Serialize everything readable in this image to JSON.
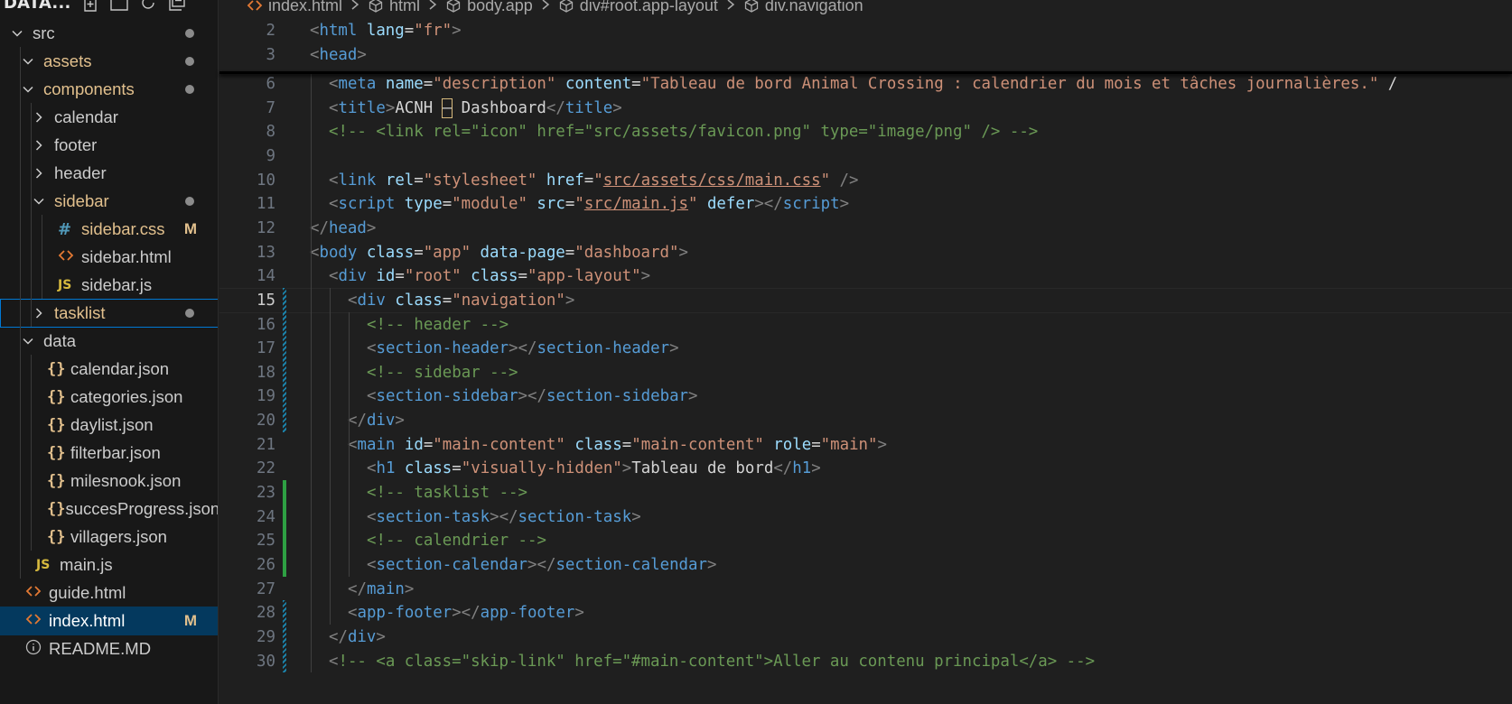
{
  "explorer": {
    "title": "DATA...",
    "tree": [
      {
        "label": "src",
        "kind": "folder-open",
        "depth": 0,
        "status": "dot"
      },
      {
        "label": "assets",
        "kind": "folder-open",
        "depth": 1,
        "status": "dot",
        "modified": true
      },
      {
        "label": "components",
        "kind": "folder-open",
        "depth": 1,
        "status": "dot",
        "modified": true
      },
      {
        "label": "calendar",
        "kind": "folder-closed",
        "depth": 2
      },
      {
        "label": "footer",
        "kind": "folder-closed",
        "depth": 2
      },
      {
        "label": "header",
        "kind": "folder-closed",
        "depth": 2
      },
      {
        "label": "sidebar",
        "kind": "folder-open",
        "depth": 2,
        "status": "dot",
        "modified": true
      },
      {
        "label": "sidebar.css",
        "kind": "css",
        "icon": "#",
        "depth": 3,
        "badge": "M",
        "modified": true
      },
      {
        "label": "sidebar.html",
        "kind": "html",
        "icon": "<>",
        "depth": 3
      },
      {
        "label": "sidebar.js",
        "kind": "js",
        "icon": "JS",
        "depth": 3
      },
      {
        "label": "tasklist",
        "kind": "folder-closed",
        "depth": 2,
        "status": "dot",
        "modified": true,
        "focused": true
      },
      {
        "label": "data",
        "kind": "folder-open",
        "depth": 1
      },
      {
        "label": "calendar.json",
        "kind": "json",
        "icon": "{}",
        "depth": 2
      },
      {
        "label": "categories.json",
        "kind": "json",
        "icon": "{}",
        "depth": 2
      },
      {
        "label": "daylist.json",
        "kind": "json",
        "icon": "{}",
        "depth": 2
      },
      {
        "label": "filterbar.json",
        "kind": "json",
        "icon": "{}",
        "depth": 2
      },
      {
        "label": "milesnook.json",
        "kind": "json",
        "icon": "{}",
        "depth": 2
      },
      {
        "label": "succesProgress.json",
        "kind": "json",
        "icon": "{}",
        "depth": 2
      },
      {
        "label": "villagers.json",
        "kind": "json",
        "icon": "{}",
        "depth": 2
      },
      {
        "label": "main.js",
        "kind": "js",
        "icon": "JS",
        "depth": 1
      },
      {
        "label": "guide.html",
        "kind": "html",
        "icon": "<>",
        "depth": 0
      },
      {
        "label": "index.html",
        "kind": "html",
        "icon": "<>",
        "depth": 0,
        "badge": "M",
        "active": true
      },
      {
        "label": "README.MD",
        "kind": "info",
        "depth": 0
      }
    ]
  },
  "breadcrumb": [
    "index.html",
    "html",
    "body.app",
    "div#root.app-layout",
    "div.navigation"
  ],
  "editor": {
    "current_line": 15,
    "lines": [
      {
        "n": 2,
        "indent": 0,
        "tokens": [
          [
            "br",
            "<"
          ],
          [
            "tag",
            "html"
          ],
          [
            "t",
            " "
          ],
          [
            "attr",
            "lang"
          ],
          [
            "eq",
            "="
          ],
          [
            "str",
            "\"fr\""
          ],
          [
            "br",
            ">"
          ]
        ]
      },
      {
        "n": 3,
        "indent": 0,
        "tokens": [
          [
            "br",
            "<"
          ],
          [
            "tag",
            "head"
          ],
          [
            "br",
            ">"
          ]
        ]
      },
      {
        "n": 6,
        "indent": 1,
        "tokens": [
          [
            "br",
            "<"
          ],
          [
            "tag",
            "meta"
          ],
          [
            "t",
            " "
          ],
          [
            "attr",
            "name"
          ],
          [
            "eq",
            "="
          ],
          [
            "str",
            "\"description\""
          ],
          [
            "t",
            " "
          ],
          [
            "attr",
            "content"
          ],
          [
            "eq",
            "="
          ],
          [
            "str",
            "\"Tableau de bord Animal Crossing : calendrier du mois et tâches journalières.\""
          ],
          [
            "t",
            " /"
          ]
        ]
      },
      {
        "n": 7,
        "indent": 1,
        "tokens": [
          [
            "br",
            "<"
          ],
          [
            "tag",
            "title"
          ],
          [
            "br",
            ">"
          ],
          [
            "t",
            "ACNH "
          ],
          [
            "mark",
            "–"
          ],
          [
            "t",
            " Dashboard"
          ],
          [
            "br",
            "</"
          ],
          [
            "tag",
            "title"
          ],
          [
            "br",
            ">"
          ]
        ]
      },
      {
        "n": 8,
        "indent": 1,
        "tokens": [
          [
            "com",
            "<!-- <link rel=\"icon\" href=\"src/assets/favicon.png\" type=\"image/png\" /> -->"
          ]
        ]
      },
      {
        "n": 9,
        "indent": 0,
        "tokens": []
      },
      {
        "n": 10,
        "indent": 1,
        "tokens": [
          [
            "br",
            "<"
          ],
          [
            "tag",
            "link"
          ],
          [
            "t",
            " "
          ],
          [
            "attr",
            "rel"
          ],
          [
            "eq",
            "="
          ],
          [
            "str",
            "\"stylesheet\""
          ],
          [
            "t",
            " "
          ],
          [
            "attr",
            "href"
          ],
          [
            "eq",
            "="
          ],
          [
            "str",
            "\""
          ],
          [
            "stru",
            "src/assets/css/main.css"
          ],
          [
            "str",
            "\""
          ],
          [
            "t",
            " "
          ],
          [
            "br",
            "/>"
          ]
        ]
      },
      {
        "n": 11,
        "indent": 1,
        "tokens": [
          [
            "br",
            "<"
          ],
          [
            "tag",
            "script"
          ],
          [
            "t",
            " "
          ],
          [
            "attr",
            "type"
          ],
          [
            "eq",
            "="
          ],
          [
            "str",
            "\"module\""
          ],
          [
            "t",
            " "
          ],
          [
            "attr",
            "src"
          ],
          [
            "eq",
            "="
          ],
          [
            "str",
            "\""
          ],
          [
            "stru",
            "src/main.js"
          ],
          [
            "str",
            "\""
          ],
          [
            "t",
            " "
          ],
          [
            "attr",
            "defer"
          ],
          [
            "br",
            "></"
          ],
          [
            "tag",
            "script"
          ],
          [
            "br",
            ">"
          ]
        ]
      },
      {
        "n": 12,
        "indent": 0,
        "tokens": [
          [
            "br",
            "</"
          ],
          [
            "tag",
            "head"
          ],
          [
            "br",
            ">"
          ]
        ]
      },
      {
        "n": 13,
        "indent": 0,
        "tokens": [
          [
            "br",
            "<"
          ],
          [
            "tag",
            "body"
          ],
          [
            "t",
            " "
          ],
          [
            "attr",
            "class"
          ],
          [
            "eq",
            "="
          ],
          [
            "str",
            "\"app\""
          ],
          [
            "t",
            " "
          ],
          [
            "attr",
            "data-page"
          ],
          [
            "eq",
            "="
          ],
          [
            "str",
            "\"dashboard\""
          ],
          [
            "br",
            ">"
          ]
        ]
      },
      {
        "n": 14,
        "indent": 1,
        "tokens": [
          [
            "br",
            "<"
          ],
          [
            "tag",
            "div"
          ],
          [
            "t",
            " "
          ],
          [
            "attr",
            "id"
          ],
          [
            "eq",
            "="
          ],
          [
            "str",
            "\"root\""
          ],
          [
            "t",
            " "
          ],
          [
            "attr",
            "class"
          ],
          [
            "eq",
            "="
          ],
          [
            "str",
            "\"app-layout\""
          ],
          [
            "br",
            ">"
          ]
        ]
      },
      {
        "n": 15,
        "indent": 2,
        "tokens": [
          [
            "br",
            "<"
          ],
          [
            "tag",
            "div"
          ],
          [
            "t",
            " "
          ],
          [
            "attr",
            "class"
          ],
          [
            "eq",
            "="
          ],
          [
            "str",
            "\"navigation\""
          ],
          [
            "br",
            ">"
          ]
        ]
      },
      {
        "n": 16,
        "indent": 3,
        "tokens": [
          [
            "com",
            "<!-- header -->"
          ]
        ]
      },
      {
        "n": 17,
        "indent": 3,
        "tokens": [
          [
            "br",
            "<"
          ],
          [
            "tag",
            "section-header"
          ],
          [
            "br",
            "></"
          ],
          [
            "tag",
            "section-header"
          ],
          [
            "br",
            ">"
          ]
        ]
      },
      {
        "n": 18,
        "indent": 3,
        "tokens": [
          [
            "com",
            "<!-- sidebar -->"
          ]
        ]
      },
      {
        "n": 19,
        "indent": 3,
        "tokens": [
          [
            "br",
            "<"
          ],
          [
            "tag",
            "section-sidebar"
          ],
          [
            "br",
            "></"
          ],
          [
            "tag",
            "section-sidebar"
          ],
          [
            "br",
            ">"
          ]
        ]
      },
      {
        "n": 20,
        "indent": 2,
        "tokens": [
          [
            "br",
            "</"
          ],
          [
            "tag",
            "div"
          ],
          [
            "br",
            ">"
          ]
        ]
      },
      {
        "n": 21,
        "indent": 2,
        "tokens": [
          [
            "br",
            "<"
          ],
          [
            "tag",
            "main"
          ],
          [
            "t",
            " "
          ],
          [
            "attr",
            "id"
          ],
          [
            "eq",
            "="
          ],
          [
            "str",
            "\"main-content\""
          ],
          [
            "t",
            " "
          ],
          [
            "attr",
            "class"
          ],
          [
            "eq",
            "="
          ],
          [
            "str",
            "\"main-content\""
          ],
          [
            "t",
            " "
          ],
          [
            "attr",
            "role"
          ],
          [
            "eq",
            "="
          ],
          [
            "str",
            "\"main\""
          ],
          [
            "br",
            ">"
          ]
        ]
      },
      {
        "n": 22,
        "indent": 3,
        "tokens": [
          [
            "br",
            "<"
          ],
          [
            "tag",
            "h1"
          ],
          [
            "t",
            " "
          ],
          [
            "attr",
            "class"
          ],
          [
            "eq",
            "="
          ],
          [
            "str",
            "\"visually-hidden\""
          ],
          [
            "br",
            ">"
          ],
          [
            "t",
            "Tableau de bord"
          ],
          [
            "br",
            "</"
          ],
          [
            "tag",
            "h1"
          ],
          [
            "br",
            ">"
          ]
        ]
      },
      {
        "n": 23,
        "indent": 3,
        "tokens": [
          [
            "com",
            "<!-- tasklist -->"
          ]
        ]
      },
      {
        "n": 24,
        "indent": 3,
        "tokens": [
          [
            "br",
            "<"
          ],
          [
            "tag",
            "section-task"
          ],
          [
            "br",
            "></"
          ],
          [
            "tag",
            "section-task"
          ],
          [
            "br",
            ">"
          ]
        ]
      },
      {
        "n": 25,
        "indent": 3,
        "tokens": [
          [
            "com",
            "<!-- calendrier -->"
          ]
        ]
      },
      {
        "n": 26,
        "indent": 3,
        "tokens": [
          [
            "br",
            "<"
          ],
          [
            "tag",
            "section-calendar"
          ],
          [
            "br",
            "></"
          ],
          [
            "tag",
            "section-calendar"
          ],
          [
            "br",
            ">"
          ]
        ]
      },
      {
        "n": 27,
        "indent": 2,
        "tokens": [
          [
            "br",
            "</"
          ],
          [
            "tag",
            "main"
          ],
          [
            "br",
            ">"
          ]
        ]
      },
      {
        "n": 28,
        "indent": 2,
        "tokens": [
          [
            "br",
            "<"
          ],
          [
            "tag",
            "app-footer"
          ],
          [
            "br",
            "></"
          ],
          [
            "tag",
            "app-footer"
          ],
          [
            "br",
            ">"
          ]
        ]
      },
      {
        "n": 29,
        "indent": 1,
        "tokens": [
          [
            "br",
            "</"
          ],
          [
            "tag",
            "div"
          ],
          [
            "br",
            ">"
          ]
        ]
      },
      {
        "n": 30,
        "indent": 1,
        "tokens": [
          [
            "br",
            "<"
          ],
          [
            "com",
            "!-- <a class=\"skip-link\" href=\"#main-content\">Aller au contenu principal</a> -->"
          ]
        ]
      }
    ],
    "gutter": [
      {
        "from": 15,
        "to": 20,
        "kind": "modified"
      },
      {
        "from": 23,
        "to": 26,
        "kind": "added"
      },
      {
        "from": 28,
        "to": 30,
        "kind": "modified"
      }
    ]
  },
  "colors": {
    "accent": "#0078d4",
    "active_row": "#04395e",
    "modified": "#e2c08d",
    "git_added": "#2ea043",
    "git_modified": "#1b81a8"
  }
}
